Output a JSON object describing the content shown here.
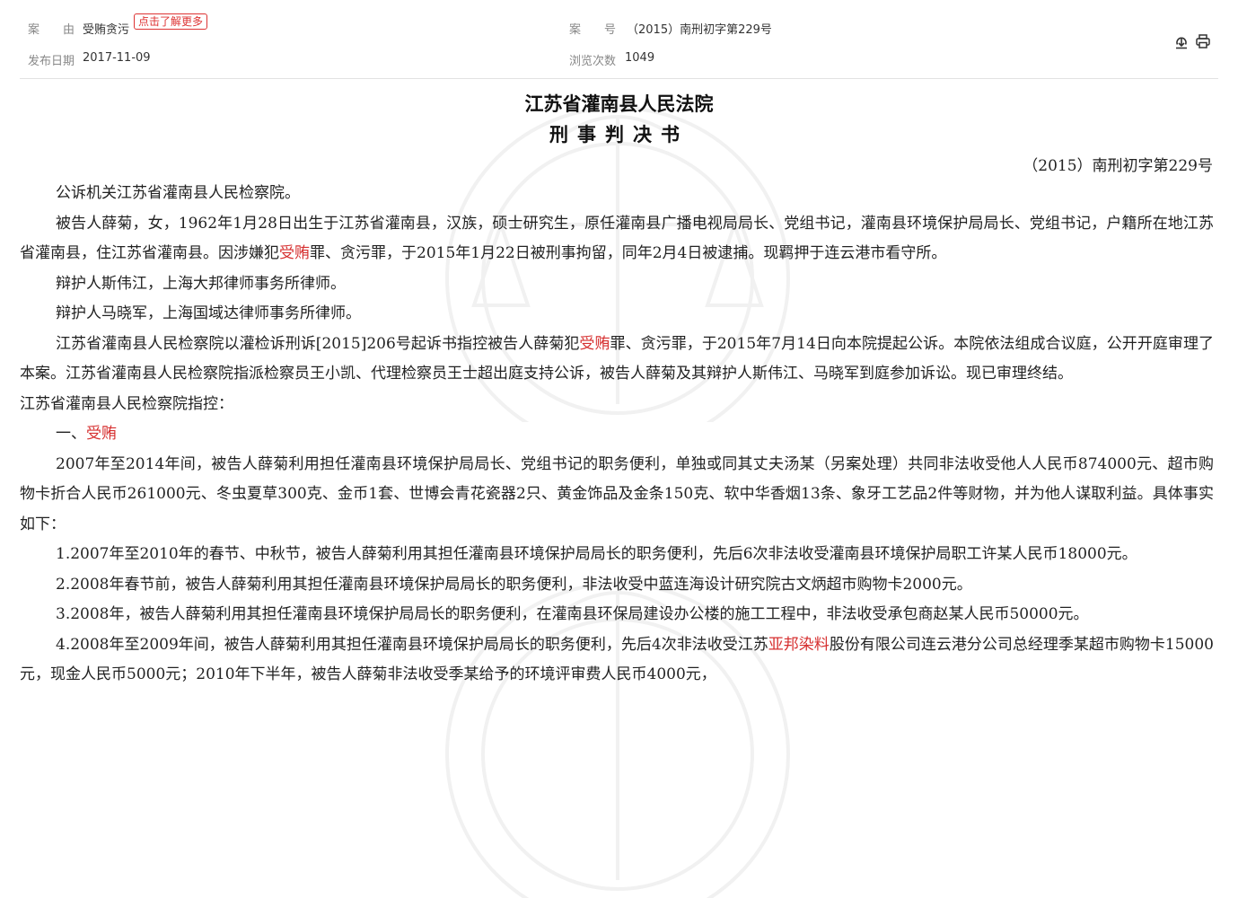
{
  "meta": {
    "cause_label": "案　　由",
    "cause_value": "受贿贪污",
    "more_link": "点击了解更多",
    "case_no_label": "案　　号",
    "case_no_value": "（2015）南刑初字第229号",
    "publish_label": "发布日期",
    "publish_value": "2017-11-09",
    "views_label": "浏览次数",
    "views_value": "1049"
  },
  "toolbar": {
    "download_icon": "download-icon",
    "print_icon": "print-icon"
  },
  "doc": {
    "court": "江苏省灌南县人民法院",
    "type": "刑事判决书",
    "case_no": "（2015）南刑初字第229号"
  },
  "paragraphs": {
    "p1": "公诉机关江苏省灌南县人民检察院。",
    "p2a": "被告人薛菊，女，1962年1月28日出生于江苏省灌南县，汉族，硕士研究生，原任灌南县广播电视局局长、党组书记，灌南县环境保护局局长、党组书记，户籍所在地江苏省灌南县，住江苏省灌南县。因涉嫌犯",
    "p2b": "受贿",
    "p2c": "罪、贪污罪，于2015年1月22日被刑事拘留，同年2月4日被逮捕。现羁押于连云港市看守所。",
    "p3": "辩护人斯伟江，上海大邦律师事务所律师。",
    "p4": "辩护人马晓军，上海国域达律师事务所律师。",
    "p5a": "江苏省灌南县人民检察院以灌检诉刑诉[2015]206号起诉书指控被告人薛菊犯",
    "p5b": "受贿",
    "p5c": "罪、贪污罪，于2015年7月14日向本院提起公诉。本院依法组成合议庭，公开开庭审理了本案。江苏省灌南县人民检察院指派检察员王小凯、代理检察员王士超出庭支持公诉，被告人薛菊及其辩护人斯伟江、马晓军到庭参加诉讼。现已审理终结。",
    "p6": "江苏省灌南县人民检察院指控：",
    "p7a": "一、",
    "p7b": "受贿",
    "p8": "2007年至2014年间，被告人薛菊利用担任灌南县环境保护局局长、党组书记的职务便利，单独或同其丈夫汤某（另案处理）共同非法收受他人人民币874000元、超市购物卡折合人民币261000元、冬虫夏草300克、金币1套、世博会青花瓷器2只、黄金饰品及金条150克、软中华香烟13条、象牙工艺品2件等财物，并为他人谋取利益。具体事实如下：",
    "p9": "1.2007年至2010年的春节、中秋节，被告人薛菊利用其担任灌南县环境保护局局长的职务便利，先后6次非法收受灌南县环境保护局职工许某人民币18000元。",
    "p10": "2.2008年春节前，被告人薛菊利用其担任灌南县环境保护局局长的职务便利，非法收受中蓝连海设计研究院古文炳超市购物卡2000元。",
    "p11": "3.2008年，被告人薛菊利用其担任灌南县环境保护局局长的职务便利，在灌南县环保局建设办公楼的施工工程中，非法收受承包商赵某人民币50000元。",
    "p12a": "4.2008年至2009年间，被告人薛菊利用其担任灌南县环境保护局局长的职务便利，先后4次非法收受江苏",
    "p12b": "亚邦染料",
    "p12c": "股份有限公司连云港分公司总经理季某超市购物卡15000元，现金人民币5000元；2010年下半年，被告人薛菊非法收受季某给予的环境评审费人民币4000元，"
  },
  "colors": {
    "highlight": "#d62f2f",
    "link_border": "#d33"
  }
}
